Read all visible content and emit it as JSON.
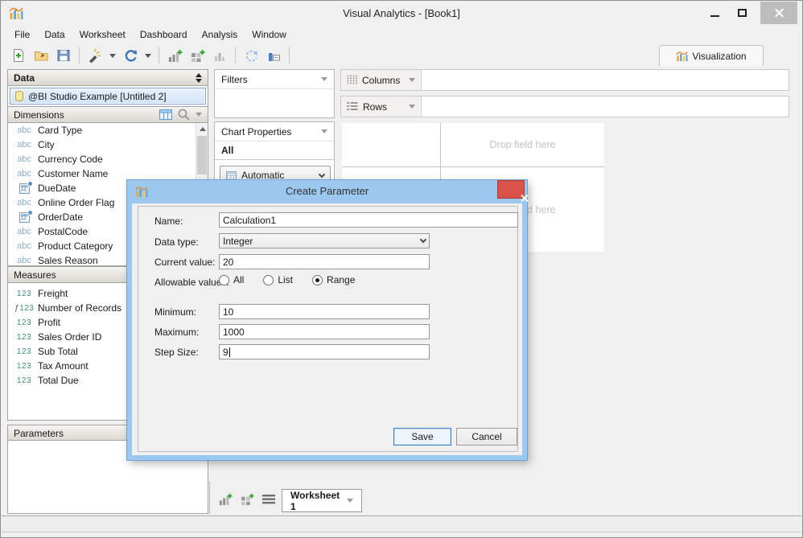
{
  "window": {
    "title": "Visual Analytics - [Book1]"
  },
  "menu": {
    "items": [
      "File",
      "Data",
      "Worksheet",
      "Dashboard",
      "Analysis",
      "Window"
    ]
  },
  "toolbar": {
    "icons": [
      "new-document",
      "open-folder",
      "save",
      "data-source-wand",
      "refresh",
      "new-worksheet",
      "new-dashboard",
      "bar-chart",
      "rotate",
      "chart-label"
    ]
  },
  "visualization_tab": {
    "label": "Visualization"
  },
  "data_panel": {
    "header": "Data",
    "source": "@BI Studio Example [Untitled 2]",
    "dimensions": {
      "header": "Dimensions",
      "items": [
        {
          "label": "Card Type",
          "type": "abc"
        },
        {
          "label": "City",
          "type": "abc"
        },
        {
          "label": "Currency Code",
          "type": "abc"
        },
        {
          "label": "Customer Name",
          "type": "abc"
        },
        {
          "label": "DueDate",
          "type": "date"
        },
        {
          "label": "Online Order Flag",
          "type": "abc"
        },
        {
          "label": "OrderDate",
          "type": "date"
        },
        {
          "label": "PostalCode",
          "type": "abc"
        },
        {
          "label": "Product Category",
          "type": "abc"
        },
        {
          "label": "Sales Reason",
          "type": "abc"
        }
      ]
    },
    "measures": {
      "header": "Measures",
      "items": [
        {
          "label": "Freight",
          "type": "123"
        },
        {
          "label": "Number of Records",
          "type": "fx123"
        },
        {
          "label": "Profit",
          "type": "123"
        },
        {
          "label": "Sales Order ID",
          "type": "123"
        },
        {
          "label": "Sub Total",
          "type": "123"
        },
        {
          "label": "Tax Amount",
          "type": "123"
        },
        {
          "label": "Total Due",
          "type": "123"
        }
      ]
    },
    "parameters": {
      "header": "Parameters"
    }
  },
  "filters_panel": {
    "header": "Filters"
  },
  "chart_properties": {
    "header": "Chart Properties",
    "scope": "All",
    "mark_type": "Automatic"
  },
  "shelves": {
    "columns": "Columns",
    "rows": "Rows"
  },
  "canvas": {
    "drop_hint_top": "Drop field here",
    "drop_hint_bottom": "Drop field here"
  },
  "dialog": {
    "title": "Create Parameter",
    "fields": {
      "name": {
        "label": "Name:",
        "value": "Calculation1"
      },
      "data_type": {
        "label": "Data type:",
        "value": "Integer"
      },
      "current_value": {
        "label": "Current value:",
        "value": "20"
      },
      "allowable_values": {
        "label": "Allowable values:",
        "options": [
          {
            "label": "All",
            "selected": false
          },
          {
            "label": "List",
            "selected": false
          },
          {
            "label": "Range",
            "selected": true
          }
        ]
      },
      "minimum": {
        "label": "Minimum:",
        "value": "10"
      },
      "maximum": {
        "label": "Maximum:",
        "value": "1000"
      },
      "step_size": {
        "label": "Step Size:",
        "value": "9"
      }
    },
    "buttons": {
      "save": "Save",
      "cancel": "Cancel"
    }
  },
  "sheet_tabs": {
    "active": "Worksheet 1"
  },
  "colors": {
    "accent_blue": "#9cc7ee",
    "close_red": "#d9534a",
    "selection_blue": "#d2e3f6",
    "dimension_icon": "#8aadd1",
    "measure_icon": "#3f8f7c",
    "drop_hint_gray": "#c4c4c4"
  }
}
